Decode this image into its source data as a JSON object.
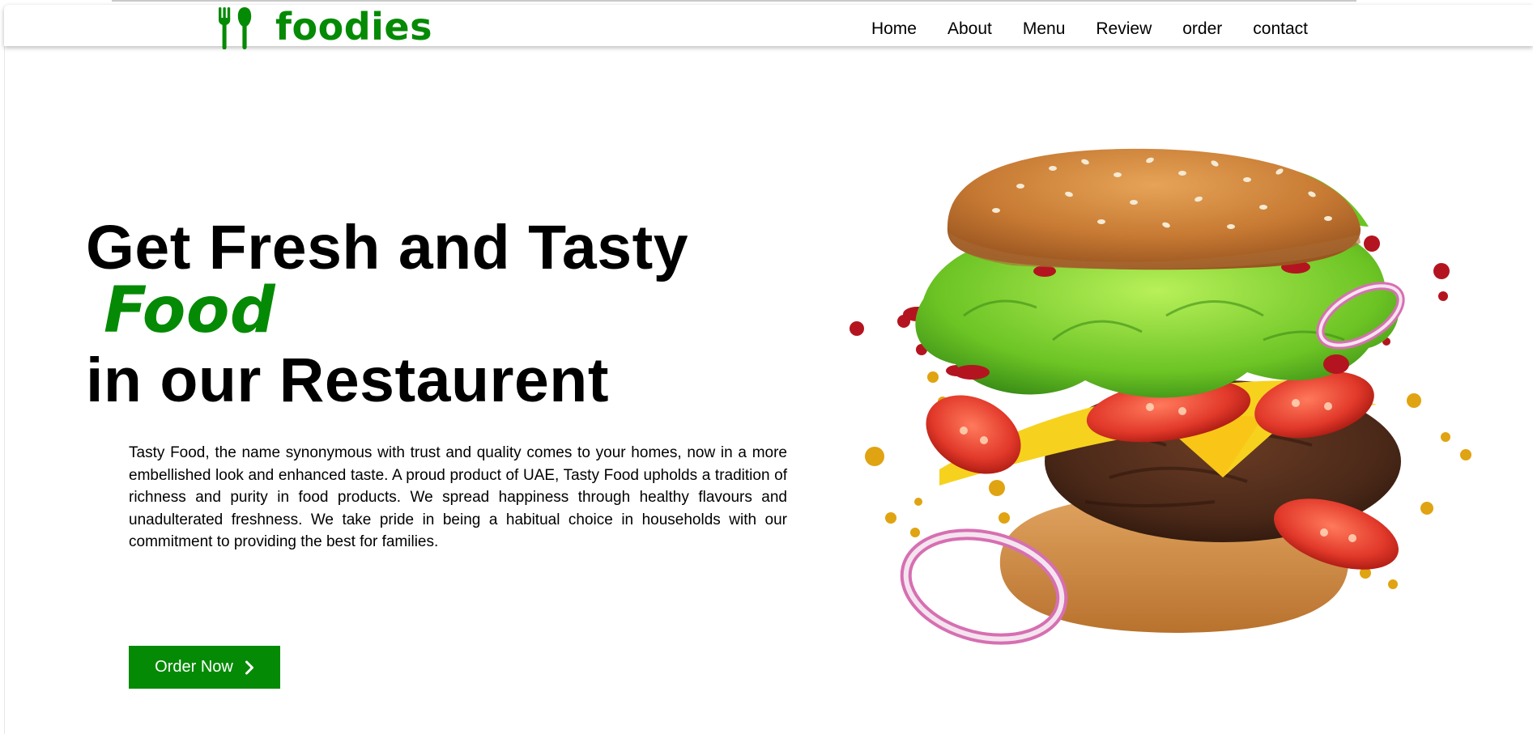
{
  "brand": {
    "name": "foodies",
    "icon": "fork-spoon-icon",
    "color": "#058a05"
  },
  "nav": {
    "items": [
      {
        "label": "Home"
      },
      {
        "label": "About"
      },
      {
        "label": "Menu"
      },
      {
        "label": "Review"
      },
      {
        "label": "order"
      },
      {
        "label": "contact"
      }
    ]
  },
  "hero": {
    "title_line1": "Get Fresh and Tasty",
    "title_accent": "Food",
    "title_line2": "in our Restaurent",
    "description": "Tasty Food, the name synonymous with trust and quality comes to your homes, now in a more embellished look and enhanced taste. A proud product of UAE, Tasty Food upholds a tradition of richness and purity in food products. We spread happiness through healthy flavours and unadulterated freshness. We take pride in being a habitual choice in households with our commitment to providing the best for families.",
    "cta_label": "Order Now",
    "cta_icon": "chevron-right-icon",
    "image": "burger-illustration"
  }
}
